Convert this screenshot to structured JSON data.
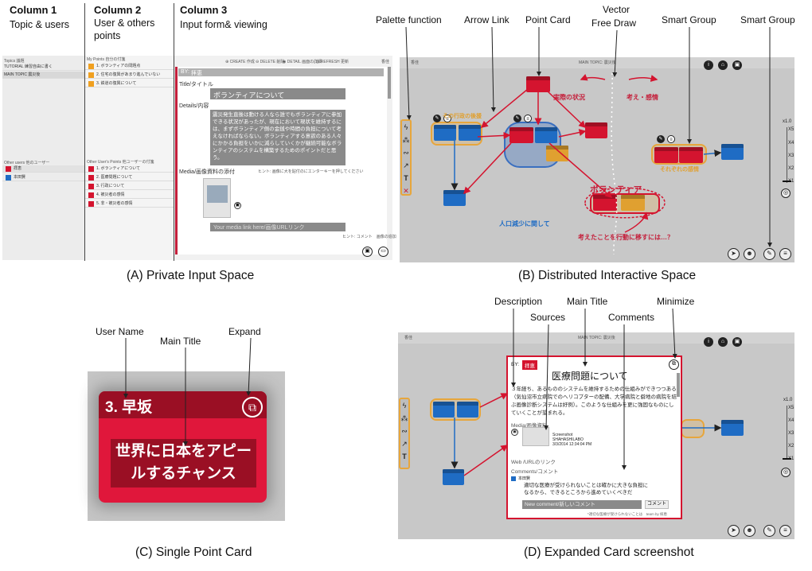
{
  "panelA": {
    "col1_title": "Column 1",
    "col1_sub": "Topic & users",
    "col2_title": "Column 2",
    "col2_sub_line1": "User & others",
    "col2_sub_line2": "points",
    "col3_title": "Column 3",
    "col3_sub": "Input  form& viewing",
    "caption": "(A) Private Input Space",
    "topics_header": "Topics 議題",
    "topic1": "TUTORIAL 練習自由に書く",
    "topic2": "MAIN TOPIC 震災後",
    "other_users_header": "Other users 他のユーザー",
    "users": [
      {
        "name": "拝恵",
        "color": "#d4142f"
      },
      {
        "name": "本田賢",
        "color": "#1f6cc4"
      }
    ],
    "my_points_header": "My Points 自分の付箋",
    "my_points": [
      "1. ボランティアの問題点",
      "2. 住宅の復興があまり進んでいない",
      "3. 鉄道の復興について"
    ],
    "others_points_header": "Other User's Points 他ユーザーの付箋",
    "others_points": [
      "1. ボランティアについて",
      "2. 医療問題について",
      "3. 行政について",
      "4. 被災者の感情",
      "5. 非・被災者の感情"
    ],
    "toolbar": [
      "CREATE 作成",
      "DELETE 削除",
      "DETAIL 画面の詳細",
      "REFRESH 更新"
    ],
    "top_right_user": "香佳",
    "by_label": "BY:",
    "by_value": "拝恵",
    "title_label": "Title/タイトル",
    "title_value": "ボランティアについて",
    "details_label": "Details/内容",
    "details_value": "震災発生直後は動ける人なら誰でもボランティアに参加できる状況があったが、現在において現状を維持するには、まずボランティア側の金銭や時間の負担について考えなければならない。ボランティアする意欲のある人々にかかる負担をいかに減らしていくかが継続可能なボランティアのシステムを構築するためのポイントだと思う。",
    "media_label": "Media/画像資料の添付",
    "media_hint": "ヒント: 画像に大を貼付のにエンターキーを押してください",
    "media_link_placeholder": "Your media link here/画像URLリンク",
    "footer_hint": "ヒント: コメント　画像の追加"
  },
  "panelB": {
    "caption": "(B)  Distributed Interactive Space",
    "labels": [
      "Palette function",
      "Arrow Link",
      "Point Card",
      "Vector",
      "Free Draw",
      "Smart Group",
      "Smart Group"
    ],
    "board_texts": [
      "実際の状況",
      "考え・感情",
      "ボランティア",
      "人口減少に関して",
      "考えたことを行動に移すには…？",
      "その行政の後援",
      "それぞれの感情"
    ],
    "zoom_label": "x1.0",
    "zoom_ticks": [
      "X5",
      "X4",
      "X3",
      "X2",
      "X1"
    ],
    "top_user": "香佳",
    "topic_tab": "MAIN TOPIC: 震災後"
  },
  "panelC": {
    "caption": "(C) Single Point Card",
    "label_user": "User Name",
    "label_title": "Main Title",
    "label_expand": "Expand",
    "card_user": "3. 早坂",
    "card_title": "世界に日本をアピールするチャンス"
  },
  "panelD": {
    "caption": "(D) Expanded Card screenshot",
    "label_description": "Description",
    "label_main_title": "Main Title",
    "label_minimize": "Minimize",
    "label_sources": "Sources",
    "label_comments": "Comments",
    "by_label": "BY:",
    "by_value": "拝恵",
    "card_title": "医療問題について",
    "description": "３年経ち、あるもののシステムを維持するための仕組みができつつある（気仙沼市立病院でのヘリコプターの配備、大学病院と僻地の病院を結ぶ画像診断システムは好例）。このような仕組みを更に強固なものにしていくことが望まれる。",
    "media_label": "Media/画像資料",
    "source_name": "Screenshot",
    "source_by": "SHAHASHILABO",
    "source_date": "3/3/2014 12:34:04 PM",
    "web_label": "Web /URLのリンク",
    "comments_label": "Comments/コメント",
    "comment_user": "本田賢",
    "comment_text": "適切な医療が受けられないことは確かに大きな負担になるから、できるところから進めていくべきだ",
    "new_comment_placeholder": "New comment/新しいコメント",
    "comment_button": "コメント",
    "footer_hint": "*適切な医療が受けられないことは　team by 拝恵"
  }
}
